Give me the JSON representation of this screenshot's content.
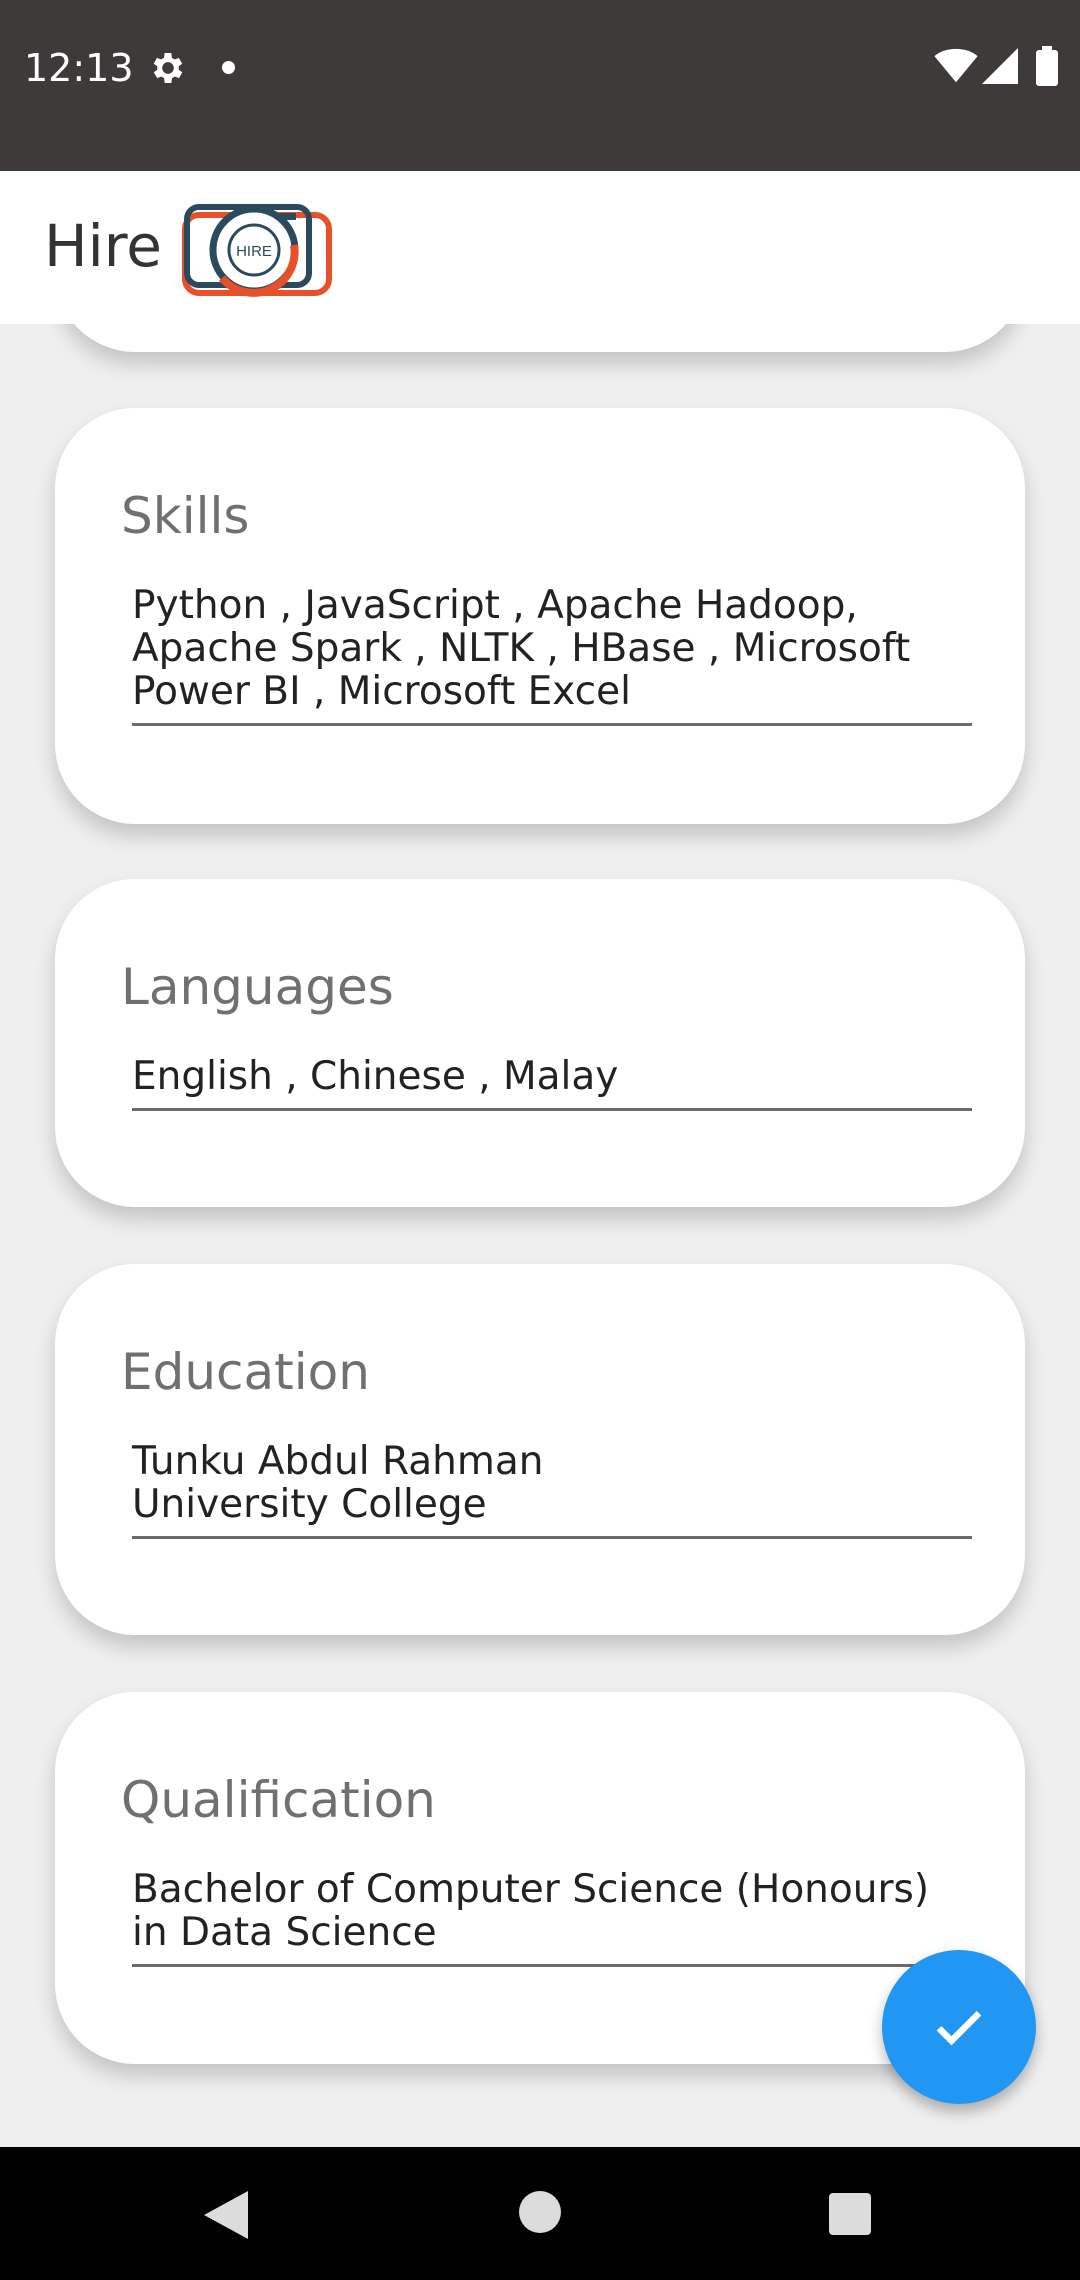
{
  "status_bar": {
    "time": "12:13",
    "icons": [
      "gear-icon",
      "notification-dot-icon",
      "wifi-icon",
      "signal-icon",
      "battery-icon"
    ]
  },
  "app_bar": {
    "title": "Hire",
    "logo_text": "HIRE"
  },
  "cards": {
    "skills": {
      "label": "Skills",
      "value": "Python , JavaScript , Apache Hadoop,\nApache Spark , NLTK , HBase , Microsoft\nPower BI , Microsoft Excel"
    },
    "languages": {
      "label": "Languages",
      "value": "English , Chinese , Malay"
    },
    "education": {
      "label": "Education",
      "value": "Tunku Abdul Rahman\nUniversity College"
    },
    "qualification": {
      "label": "Qualification",
      "value": "Bachelor of Computer Science (Honours)\nin Data Science"
    }
  },
  "fab": {
    "icon": "check-icon"
  },
  "nav_bar": {
    "icons": [
      "back-icon",
      "home-icon",
      "recents-icon"
    ]
  },
  "colors": {
    "status_bar": "#3e3a3a",
    "background": "#efefef",
    "card": "#ffffff",
    "fab": "#2196f3",
    "logo_dark": "#2b4a5e",
    "logo_accent": "#e8502a"
  }
}
